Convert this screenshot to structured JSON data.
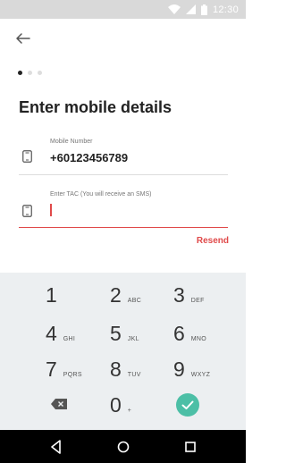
{
  "status_bar": {
    "time": "12:30"
  },
  "steps": {
    "total": 3,
    "active": 1
  },
  "page": {
    "title": "Enter mobile details"
  },
  "mobile_field": {
    "label": "Mobile Number",
    "value": "+60123456789",
    "icon": "phone-icon"
  },
  "tac_field": {
    "label": "Enter TAC (You will receive an SMS)",
    "value": "",
    "icon": "phone-icon"
  },
  "resend": {
    "label": "Resend"
  },
  "keypad": {
    "keys": [
      {
        "num": "1",
        "sub": ""
      },
      {
        "num": "2",
        "sub": "ABC"
      },
      {
        "num": "3",
        "sub": "DEF"
      },
      {
        "num": "4",
        "sub": "GHI"
      },
      {
        "num": "5",
        "sub": "JKL"
      },
      {
        "num": "6",
        "sub": "MNO"
      },
      {
        "num": "7",
        "sub": "PQRS"
      },
      {
        "num": "8",
        "sub": "TUV"
      },
      {
        "num": "9",
        "sub": "WXYZ"
      },
      {
        "num": "0",
        "sub": "+"
      }
    ],
    "backspace_icon": "backspace-icon",
    "confirm_icon": "check-icon"
  },
  "nav": {
    "icons": [
      "back-triangle-icon",
      "home-circle-icon",
      "recents-square-icon"
    ]
  },
  "colors": {
    "accent": "#e04a4a",
    "confirm": "#4cbfa6",
    "keypad_bg": "#eceff1",
    "status_bar": "#d9d9d9"
  }
}
